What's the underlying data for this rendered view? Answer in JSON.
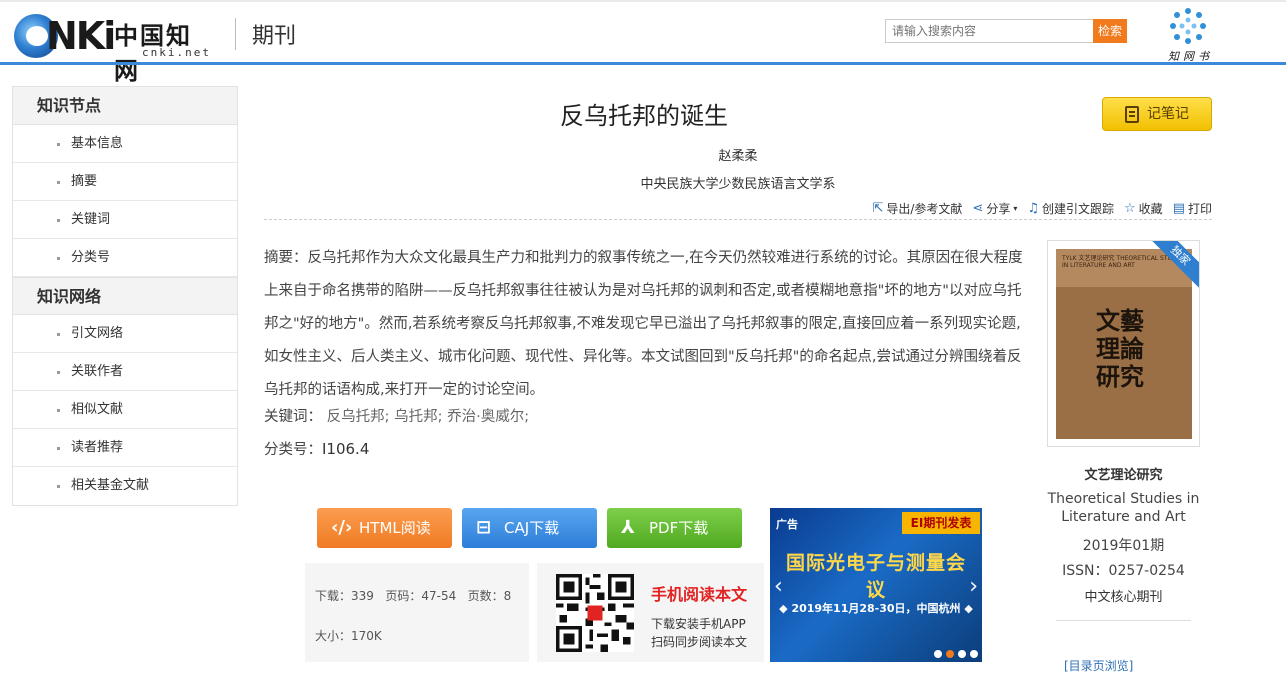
{
  "header": {
    "logo_text": "CNKi",
    "logo_cn": "中国知网",
    "logo_domain": "cnki.net",
    "section": "期刊",
    "search_placeholder": "请输入搜索内容",
    "search_button": "检索",
    "app_logo_text": "知网书"
  },
  "sidebar": {
    "group1": {
      "title": "知识节点",
      "items": [
        "基本信息",
        "摘要",
        "关键词",
        "分类号"
      ]
    },
    "group2": {
      "title": "知识网络",
      "items": [
        "引文网络",
        "关联作者",
        "相似文献",
        "读者推荐",
        "相关基金文献"
      ]
    }
  },
  "article": {
    "title": "反乌托邦的诞生",
    "note_button": "记笔记",
    "author": "赵柔柔",
    "organization": "中央民族大学少数民族语言文学系",
    "tools": [
      "导出/参考文献",
      "分享",
      "创建引文跟踪",
      "收藏",
      "打印"
    ],
    "abstract_label": "摘要：",
    "abstract": "反乌托邦作为大众文化最具生产力和批判力的叙事传统之一,在今天仍然较难进行系统的讨论。其原因在很大程度上来自于命名携带的陷阱——反乌托邦叙事往往被认为是对乌托邦的讽刺和否定,或者模糊地意指\"坏的地方\"以对应乌托邦之\"好的地方\"。然而,若系统考察反乌托邦叙事,不难发现它早已溢出了乌托邦叙事的限定,直接回应着一系列现实论题,如女性主义、后人类主义、城市化问题、现代性、异化等。本文试图回到\"反乌托邦\"的命名起点,尝试通过分辨围绕着反乌托邦的话语构成,来打开一定的讨论空间。",
    "keywords_label": "关键词：",
    "keywords": [
      "反乌托邦;",
      "乌托邦;",
      "乔治·奥威尔;"
    ],
    "class_label": "分类号：",
    "class_no": "I106.4"
  },
  "journal": {
    "ribbon": "独家",
    "cover_band": "TYLK 文艺理论研究 THEORETICAL STUDIES IN LITERATURE AND ART",
    "cover_title": "文藝 理論 研究",
    "name_cn": "文艺理论研究",
    "name_en": "Theoretical Studies in Literature and Art",
    "issue": "2019年01期",
    "issn": "ISSN：0257-0254",
    "core": "中文核心期刊",
    "browse": "[目录页浏览]"
  },
  "actions": {
    "html": "HTML阅读",
    "caj": "CAJ下载",
    "pdf": "PDF下载"
  },
  "stats": {
    "line1": "下载：339   页码：47-54   页数：8",
    "line2": "大小：170K"
  },
  "mobile": {
    "title": "手机阅读本文",
    "line1": "下载安装手机APP",
    "line2": "扫码同步阅读本文"
  },
  "ad": {
    "tag": "广告",
    "badge": "EI期刊发表",
    "title": "国际光电子与测量会议",
    "date": "◆ 2019年11月28-30日，中国杭州 ◆"
  },
  "colors": {
    "accent_blue": "#3a8ad8",
    "search_orange": "#f07a1c",
    "note_yellow": "#f1c000"
  }
}
